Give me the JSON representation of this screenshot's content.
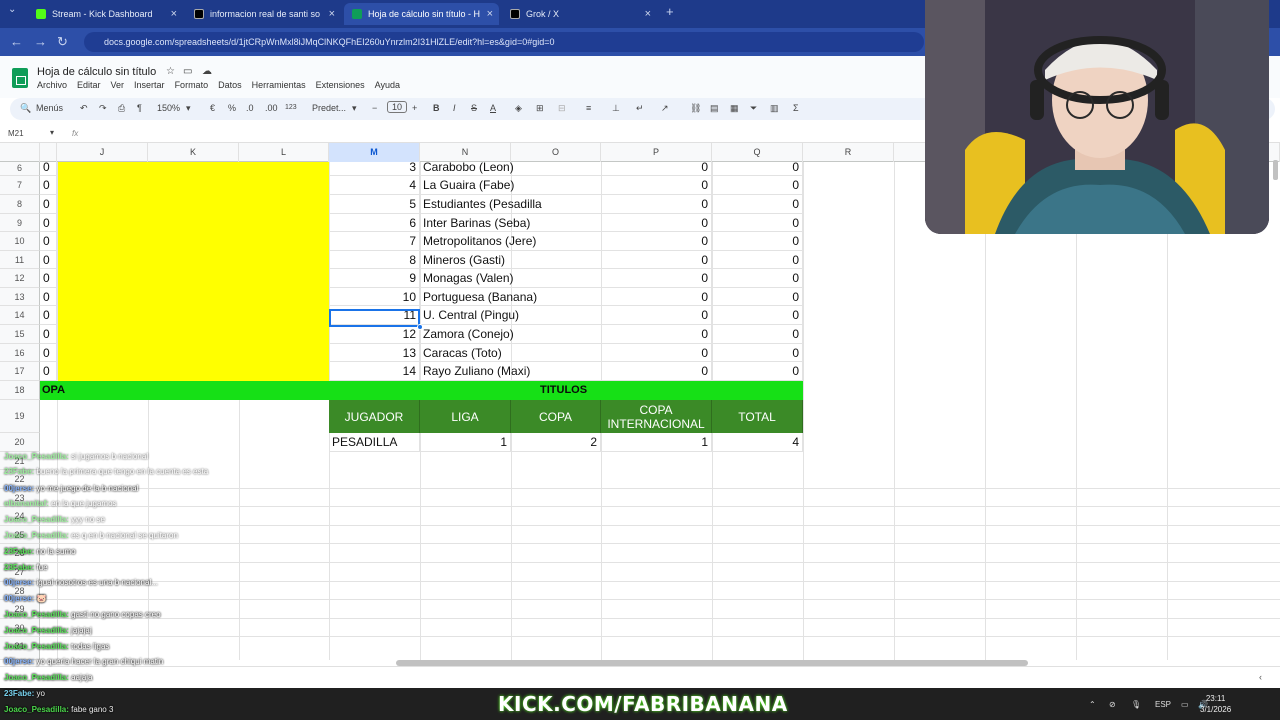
{
  "browser": {
    "tabs": [
      {
        "label": "Stream - Kick Dashboard",
        "icon": "kick-icon"
      },
      {
        "label": "informacion real de santi sosa",
        "icon": "x-icon"
      },
      {
        "label": "Hoja de cálculo sin título - Hoja",
        "icon": "sheets-icon"
      },
      {
        "label": "Grok / X",
        "icon": "x-icon"
      }
    ],
    "url": "docs.google.com/spreadsheets/d/1jtCRpWnMxl8iJMqClNKQFhEI260uYnrzlm2I31HlZLE/edit?hl=es&gid=0#gid=0"
  },
  "sheets": {
    "title": "Hoja de cálculo sin título",
    "menu": [
      "Archivo",
      "Editar",
      "Ver",
      "Insertar",
      "Formato",
      "Datos",
      "Herramientas",
      "Extensiones",
      "Ayuda"
    ],
    "toolbar": {
      "menus": "Menús",
      "zoom": "150%",
      "euro": "€",
      "percent": "%",
      "decimals_down": ".0",
      "decimals_up": ".00",
      "number_format": "123",
      "font": "Predet...",
      "font_size": "10",
      "bold": "B",
      "italic": "I",
      "strike": "S",
      "text_color": "A"
    },
    "name_box": "M21",
    "fx": "fx",
    "columns": [
      "J",
      "K",
      "L",
      "M",
      "N",
      "O",
      "P",
      "Q",
      "R"
    ],
    "rows": [
      "6",
      "7",
      "8",
      "9",
      "10",
      "11",
      "12",
      "13",
      "14",
      "15",
      "16",
      "17",
      "18",
      "19",
      "20",
      "21",
      "22",
      "23",
      "24",
      "25",
      "26",
      "27",
      "28",
      "29",
      "30",
      "31"
    ],
    "table": [
      {
        "j": "0",
        "m": "3",
        "n": "Carabobo (Leon)",
        "p": "0",
        "q": "0"
      },
      {
        "j": "0",
        "m": "4",
        "n": "La Guaira (Fabe)",
        "p": "0",
        "q": "0"
      },
      {
        "j": "0",
        "m": "5",
        "n": "Estudiantes (Pesadilla",
        "p": "0",
        "q": "0"
      },
      {
        "j": "0",
        "m": "6",
        "n": "Inter Barinas (Seba)",
        "p": "0",
        "q": "0"
      },
      {
        "j": "0",
        "m": "7",
        "n": "Metropolitanos (Jere)",
        "p": "0",
        "q": "0"
      },
      {
        "j": "0",
        "m": "8",
        "n": "Mineros (Gasti)",
        "p": "0",
        "q": "0"
      },
      {
        "j": "0",
        "m": "9",
        "n": "Monagas (Valen)",
        "p": "0",
        "q": "0"
      },
      {
        "j": "0",
        "m": "10",
        "n": "Portuguesa (Banana)",
        "p": "0",
        "q": "0"
      },
      {
        "j": "0",
        "m": "11",
        "n": "U. Central (Pingu)",
        "p": "0",
        "q": "0"
      },
      {
        "j": "0",
        "m": "12",
        "n": "Zamora (Conejo)",
        "p": "0",
        "q": "0"
      },
      {
        "j": "0",
        "m": "13",
        "n": "Caracas (Toto)",
        "p": "0",
        "q": "0"
      },
      {
        "j": "0",
        "m": "14",
        "n": "Rayo Zuliano (Maxi)",
        "p": "0",
        "q": "0"
      }
    ],
    "copa_label": "OPA",
    "titulos_label": "TITULOS",
    "titulos_headers": [
      "JUGADOR",
      "LIGA",
      "COPA",
      "COPA INTERNACIONAL",
      "TOTAL"
    ],
    "titulos_row": [
      "PESADILLA",
      "1",
      "2",
      "1",
      "4"
    ]
  },
  "chat": [
    {
      "user": "Joaco_Pesadilla:",
      "msg": "si jugamos b nacional"
    },
    {
      "user": "23Fabe:",
      "msg": "bueno la primera que tengo en la cuenta es esta"
    },
    {
      "user": "00jerse:",
      "msg": "yo me juego de la b nacional"
    },
    {
      "user": "elbananitaf:",
      "msg": "en la que jugamos"
    },
    {
      "user": "Joaco_Pesadilla:",
      "msg": "yyy no se"
    },
    {
      "user": "Joaco_Pesadilla:",
      "msg": "es q en b nacional se quitaron"
    },
    {
      "user": "23Fabe:",
      "msg": "no la sumo"
    },
    {
      "user": "23Fabe:",
      "msg": "fue"
    },
    {
      "user": "00jerse:",
      "msg": "igual nosotros es una b nacional..."
    },
    {
      "user": "00jerse:",
      "msg": "🐷"
    },
    {
      "user": "Joaco_Pesadilla:",
      "msg": "gasti no gano copas creo"
    },
    {
      "user": "Joaco_Pesadilla:",
      "msg": "jajajaj"
    },
    {
      "user": "Joaco_Pesadilla:",
      "msg": "todas ligas"
    },
    {
      "user": "00jerse:",
      "msg": "yo queria hacer la gran chiqui matin"
    },
    {
      "user": "Joaco_Pesadilla:",
      "msg": "aajaja"
    },
    {
      "user": "23Fabe:",
      "msg": "yo"
    },
    {
      "user": "Joaco_Pesadilla:",
      "msg": "fabe gano 3"
    }
  ],
  "overlay": {
    "kick_url": "KICK.COM/FABRIBANANA"
  },
  "taskbar": {
    "lang": "ESP",
    "time": "23:11",
    "date": "3/1/2026"
  },
  "colors": {
    "yellow": "#ffff00",
    "green_bar": "#16e016",
    "header_green": "#3b8a27",
    "selection": "#1a73e8"
  }
}
